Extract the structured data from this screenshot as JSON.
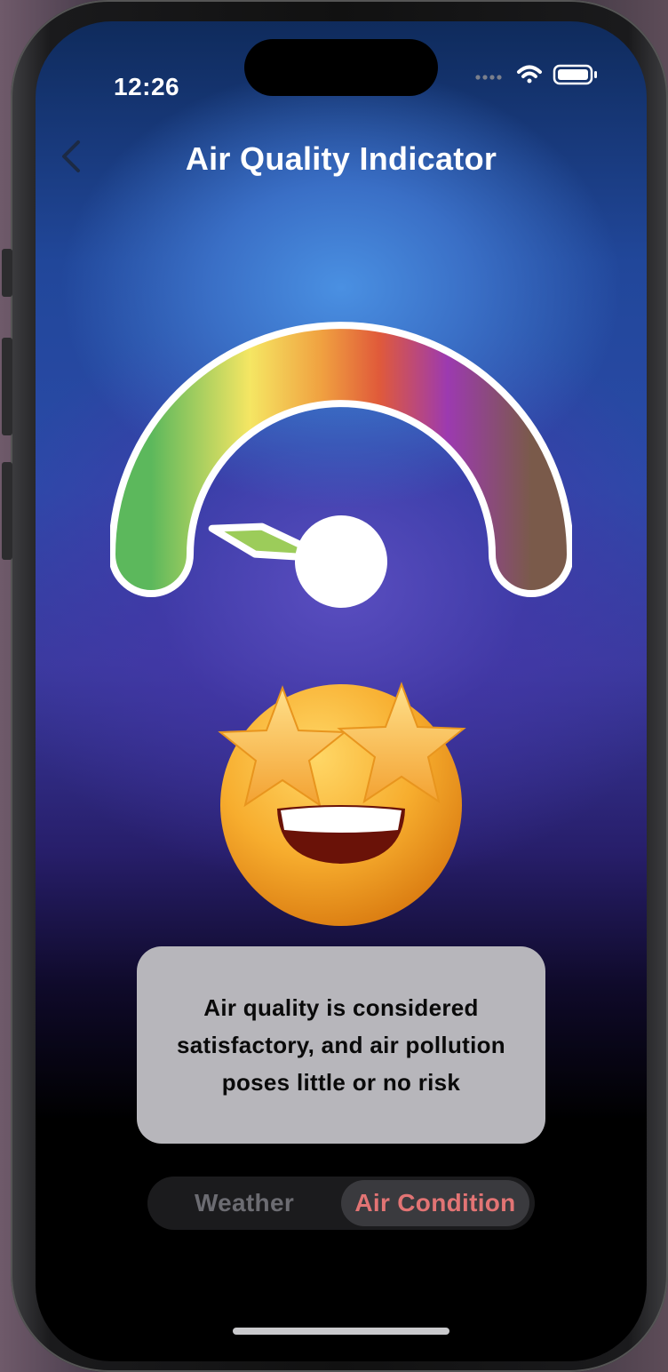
{
  "status_bar": {
    "time": "12:26",
    "signal_icon": "cellular-dots-icon",
    "wifi_icon": "wifi-icon",
    "battery_icon": "battery-icon"
  },
  "header": {
    "back_icon": "chevron-left-icon",
    "title": "Air Quality Indicator"
  },
  "gauge": {
    "scale_colors": [
      "#5cb85c",
      "#f5e663",
      "#f0a040",
      "#e05a3a",
      "#9c3ab0",
      "#7a5a4a"
    ],
    "needle_color": "#9ccc5a",
    "level_fraction": 0.08
  },
  "emoji": {
    "icon": "star-struck-emoji-icon"
  },
  "message": {
    "text": "Air quality is considered satisfactory, and air pollution poses little or no risk"
  },
  "tabs": [
    {
      "label": "Weather",
      "selected": false
    },
    {
      "label": "Air Condition",
      "selected": true
    }
  ],
  "colors": {
    "selected_tab_text": "#e27474",
    "card_background": "#b7b6bb"
  }
}
